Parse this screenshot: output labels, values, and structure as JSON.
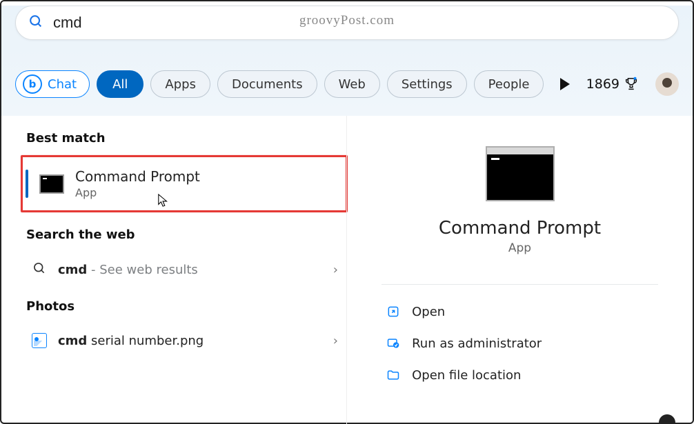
{
  "watermark": "groovyPost.com",
  "search": {
    "query": "cmd"
  },
  "filters": {
    "chat": "Chat",
    "all": "All",
    "apps": "Apps",
    "documents": "Documents",
    "web": "Web",
    "settings": "Settings",
    "people": "People"
  },
  "rewards": {
    "points": "1869"
  },
  "results": {
    "bestMatchLabel": "Best match",
    "bestMatch": {
      "title": "Command Prompt",
      "subtitle": "App"
    },
    "searchWebLabel": "Search the web",
    "webrow": {
      "bold": "cmd",
      "rest": " - See web results"
    },
    "photosLabel": "Photos",
    "photorow": {
      "bold": "cmd",
      "rest": " serial number.png"
    }
  },
  "preview": {
    "title": "Command Prompt",
    "subtitle": "App",
    "actions": {
      "open": "Open",
      "admin": "Run as administrator",
      "loc": "Open file location"
    }
  }
}
